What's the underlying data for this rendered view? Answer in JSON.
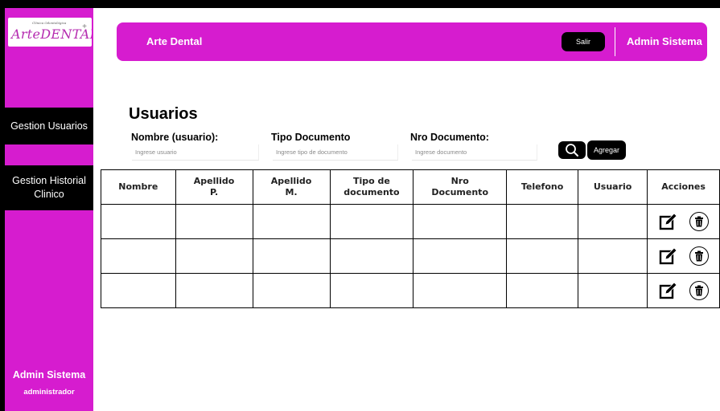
{
  "sidebar": {
    "logo": {
      "main": "ArteDENTAL",
      "small": "Clínica Odontológica"
    },
    "menu": [
      {
        "label": "Gestion Usuarios"
      },
      {
        "label": "Gestion Historial Clinico"
      }
    ],
    "user": {
      "name": "Admin Sistema",
      "role": "administrador"
    }
  },
  "topbar": {
    "brand": "Arte Dental",
    "logout_label": "Salir",
    "user_name": "Admin Sistema"
  },
  "page": {
    "title": "Usuarios"
  },
  "filters": {
    "username": {
      "label": "Nombre (usuario):",
      "placeholder": "Ingrese usuario"
    },
    "doc_type": {
      "label": "Tipo Documento",
      "placeholder": "Ingrese tipo de documento"
    },
    "doc_number": {
      "label": "Nro Documento:",
      "placeholder": "Ingrese documento"
    },
    "search_icon": "search-icon",
    "add_label": "Agregar"
  },
  "table": {
    "headers": [
      "Nombre",
      "Apellido P.",
      "Apellido M.",
      "Tipo de documento",
      "Nro Documento",
      "Telefono",
      "Usuario",
      "Acciones"
    ],
    "rows": [
      [
        "",
        "",
        "",
        "",
        "",
        "",
        ""
      ],
      [
        "",
        "",
        "",
        "",
        "",
        "",
        ""
      ],
      [
        "",
        "",
        "",
        "",
        "",
        "",
        ""
      ]
    ],
    "action_icons": [
      "edit-icon",
      "delete-icon"
    ]
  },
  "colors": {
    "accent": "#d61ccf",
    "button": "#000000",
    "text_on_accent": "#ffffff"
  }
}
